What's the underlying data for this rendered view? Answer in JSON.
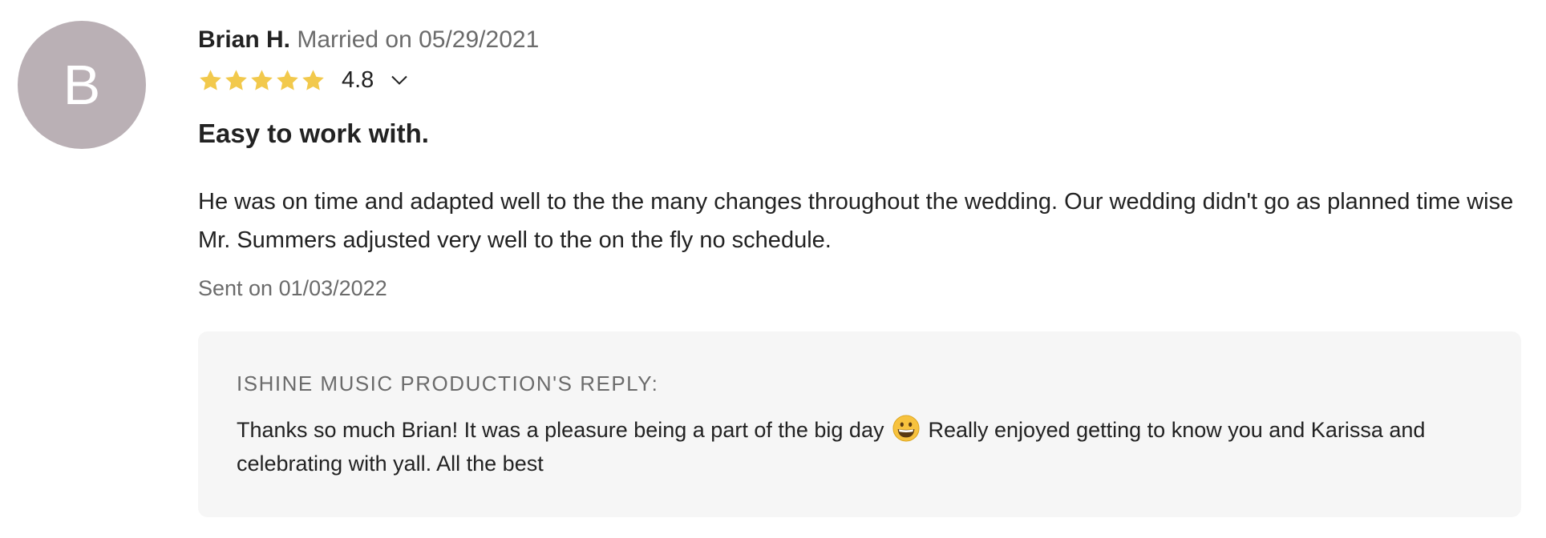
{
  "avatar": {
    "initial": "B",
    "color": "#bab0b5"
  },
  "review": {
    "reviewer_name": "Brian H.",
    "married_text": "Married on 05/29/2021",
    "rating_stars": 5,
    "rating_value": "4.8",
    "star_color": "#f2c94c",
    "title": "Easy to work with.",
    "body": "He was on time and adapted well to the the many changes throughout the wedding. Our wedding didn't go as planned time wise Mr. Summers adjusted very well to the on the fly no schedule.",
    "sent_date": "Sent on 01/03/2022"
  },
  "reply": {
    "heading": "ISHINE MUSIC PRODUCTION'S REPLY:",
    "text_before": "Thanks so much Brian! It was a pleasure being a part of the big day",
    "emoji": "grinning-face-emoji",
    "text_after": "Really enjoyed getting to know you and Karissa and celebrating with yall. All the best"
  }
}
